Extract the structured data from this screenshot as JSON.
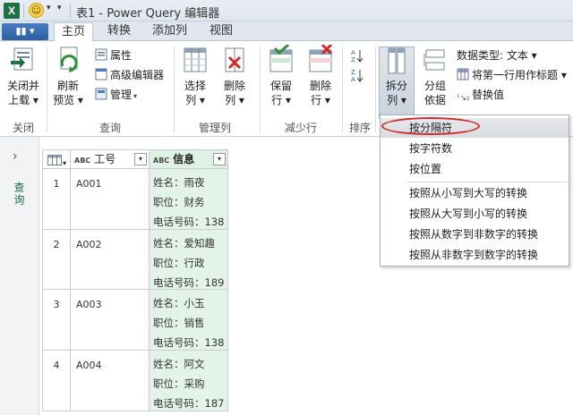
{
  "window": {
    "title": "表1 - Power Query 编辑器"
  },
  "quick_access": {
    "icons": [
      "excel-logo-icon",
      "smiley-icon",
      "dropdown-arrow-icon"
    ]
  },
  "tabs": {
    "file": "▮▮ ▾",
    "home": "主页",
    "transform": "转换",
    "add_column": "添加列",
    "view": "视图"
  },
  "ribbon": {
    "close_group": {
      "btn": [
        "关闭并",
        "上载 ▾"
      ],
      "label": "关闭"
    },
    "query_group": {
      "refresh": [
        "刷新",
        "预览 ▾"
      ],
      "properties": "属性",
      "advanced_editor": "高级编辑器",
      "manage": "管理",
      "label": "查询"
    },
    "manage_cols_group": {
      "choose": [
        "选择",
        "列 ▾"
      ],
      "remove": [
        "删除",
        "列 ▾"
      ],
      "label": "管理列"
    },
    "reduce_rows_group": {
      "keep": [
        "保留",
        "行 ▾"
      ],
      "remove": [
        "删除",
        "行 ▾"
      ],
      "label": "减少行"
    },
    "sort_group": {
      "label": "排序"
    },
    "split_col": [
      "拆分",
      "列 ▾"
    ],
    "group_by": [
      "分组",
      "依据"
    ],
    "data_type": "数据类型: 文本 ▾",
    "first_row_header": "将第一行用作标题 ▾",
    "replace_values": "替换值"
  },
  "nav": {
    "label": "查询"
  },
  "grid": {
    "headers": {
      "col1": "工号",
      "col2": "信息",
      "abc": "ABC"
    },
    "rows": [
      {
        "num": "1",
        "id": "A001",
        "info": [
          "姓名：雨夜",
          "职位：财务",
          "电话号码：138"
        ]
      },
      {
        "num": "2",
        "id": "A002",
        "info": [
          "姓名：爱知趣",
          "职位：行政",
          "电话号码：189"
        ]
      },
      {
        "num": "3",
        "id": "A003",
        "info": [
          "姓名：小玉",
          "职位：销售",
          "电话号码：138"
        ]
      },
      {
        "num": "4",
        "id": "A004",
        "info": [
          "姓名：阿文",
          "职位：采购",
          "电话号码：187"
        ]
      }
    ]
  },
  "menu": {
    "items": [
      "按分隔符",
      "按字符数",
      "按位置",
      "按照从小写到大写的转换",
      "按照从大写到小写的转换",
      "按照从数字到非数字的转换",
      "按照从非数字到数字的转换"
    ]
  },
  "colors": {
    "accent_green": "#1e7145",
    "highlight_red": "#d02a2a",
    "info_col_bg": "#e3f3ea"
  }
}
